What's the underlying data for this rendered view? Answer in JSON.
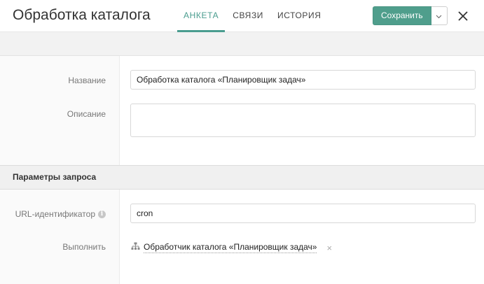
{
  "header": {
    "title": "Обработка каталога",
    "tabs": [
      {
        "label": "АНКЕТА",
        "active": true
      },
      {
        "label": "СВЯЗИ",
        "active": false
      },
      {
        "label": "ИСТОРИЯ",
        "active": false
      }
    ],
    "save_label": "Сохранить"
  },
  "form": {
    "name": {
      "label": "Название",
      "value": "Обработка каталога «Планировщик задач»"
    },
    "description": {
      "label": "Описание",
      "value": ""
    }
  },
  "request_params": {
    "title": "Параметры запроса",
    "url_id": {
      "label": "URL-идентификатор",
      "info_icon": "i",
      "value": "cron"
    },
    "execute": {
      "label": "Выполнить",
      "value": "Обработчик каталога «Планировщик задач»",
      "remove_icon": "×"
    }
  },
  "colors": {
    "accent": "#4f9e8c",
    "active_tab": "#4a9d8f"
  },
  "icons": {
    "dropdown": "chevron-down-icon",
    "close": "close-icon",
    "info": "info-icon",
    "hierarchy": "hierarchy-icon",
    "remove": "remove-icon"
  }
}
